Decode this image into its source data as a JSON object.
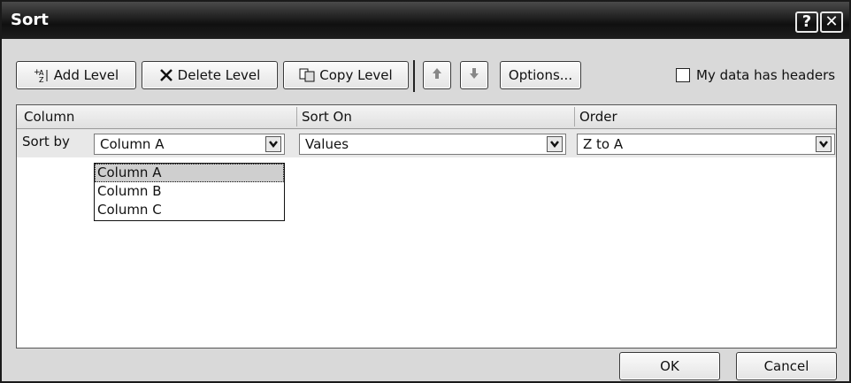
{
  "title": "Sort",
  "titlebar": {
    "help": "?",
    "close": "✕"
  },
  "toolbar": {
    "add_level": "Add Level",
    "delete_level": "Delete Level",
    "copy_level": "Copy Level",
    "options": "Options...",
    "headers_checkbox_label": "My data has headers",
    "headers_checked": false
  },
  "grid": {
    "headers": [
      "Column",
      "Sort On",
      "Order"
    ],
    "row": {
      "label": "Sort by",
      "column": "Column A",
      "sort_on": "Values",
      "order": "Z to A"
    },
    "column_options": [
      "Column A",
      "Column B",
      "Column C"
    ],
    "selected_option": "Column A"
  },
  "footer": {
    "ok": "OK",
    "cancel": "Cancel"
  }
}
